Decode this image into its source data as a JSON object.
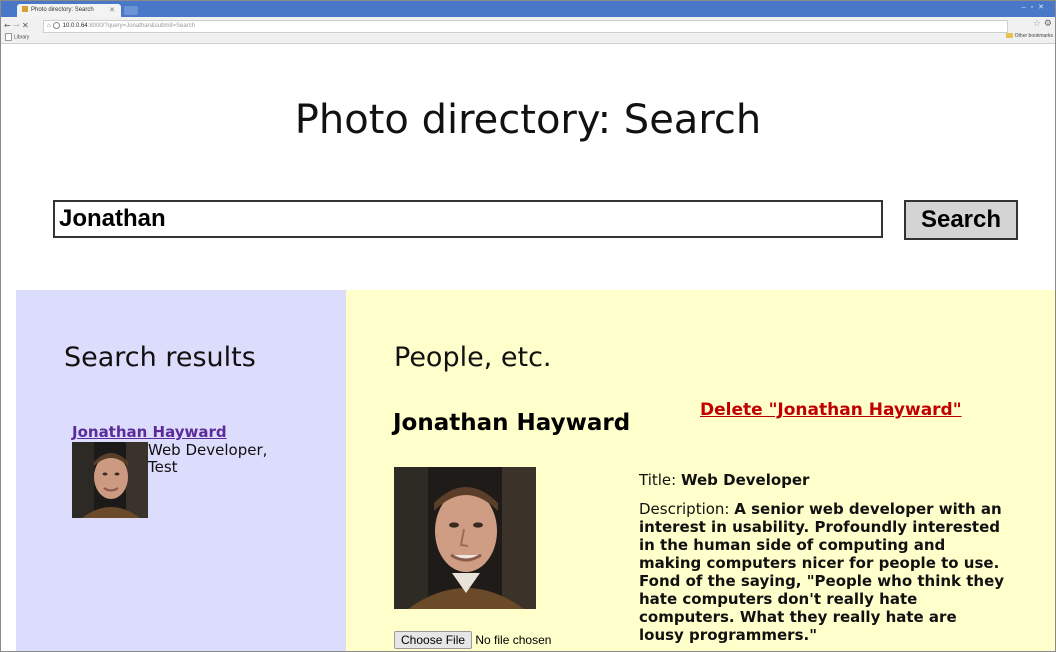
{
  "browser": {
    "tab_title": "Photo directory: Search",
    "url_host": "10.0.0.64",
    "url_path": ":8000/?query=Jonathan&submit=Search",
    "bookmark_left": "Library",
    "bookmark_right": "Other bookmarks"
  },
  "page": {
    "title": "Photo directory: Search"
  },
  "search": {
    "query": "Jonathan",
    "button_label": "Search"
  },
  "results": {
    "heading": "Search results",
    "items": [
      {
        "name": "Jonathan Hayward",
        "summary": "Web Developer, Test"
      }
    ]
  },
  "people": {
    "heading": "People, etc.",
    "person": {
      "name": "Jonathan Hayward",
      "delete_label": "Delete \"Jonathan Hayward\"",
      "title_label": "Title:",
      "title_value": "Web Developer",
      "description_label": "Description:",
      "description_value": "A senior web developer with an interest in usability. Profoundly interested in the human side of computing and making computers nicer for people to use. Fond of the saying, \"People who think they hate computers don't really hate computers. What they really hate are lousy programmers.\""
    },
    "file_input": {
      "button_label": "Choose File",
      "status": "No file chosen"
    }
  },
  "colors": {
    "results_bg": "#dcdcfc",
    "people_bg": "#ffffcc",
    "delete_red": "#c00000",
    "link_purple": "#5b2b98"
  }
}
